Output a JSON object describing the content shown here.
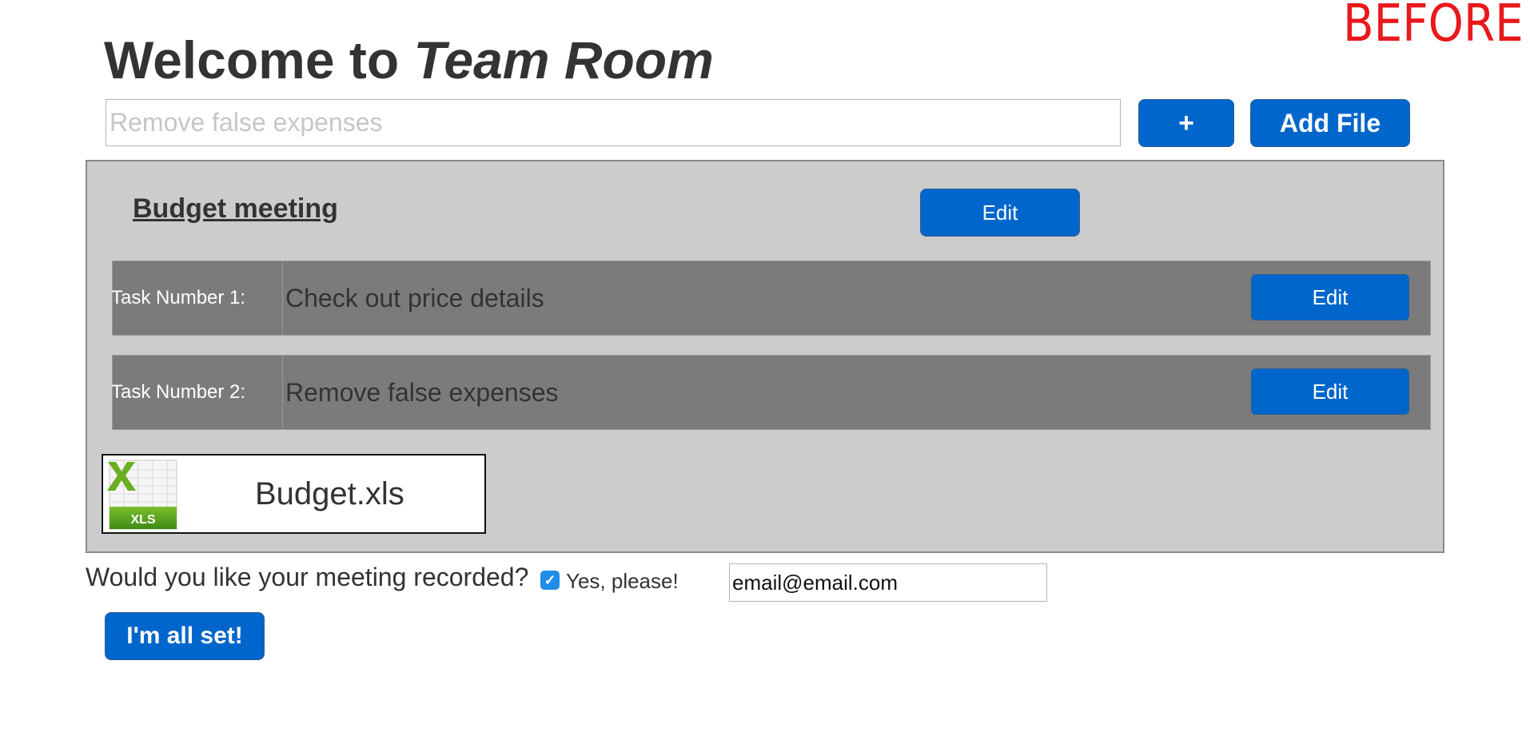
{
  "corner_label": "BEFORE",
  "header": {
    "title_prefix": "Welcome to ",
    "title_emphasis": "Team Room"
  },
  "task_input": {
    "value": "",
    "placeholder": "Remove false expenses"
  },
  "toolbar": {
    "add_label": "+",
    "add_file_label": "Add File"
  },
  "meeting": {
    "title": "Budget meeting",
    "edit_label": "Edit",
    "tasks": [
      {
        "label": "Task Number 1:",
        "text": "Check out price details",
        "edit_label": "Edit"
      },
      {
        "label": "Task Number 2:",
        "text": "Remove false expenses",
        "edit_label": "Edit"
      }
    ],
    "file": {
      "icon": "xls-file-icon",
      "icon_text": "XLS",
      "name": "Budget.xls"
    }
  },
  "recording": {
    "question": "Would you like your meeting recorded?",
    "checked": true,
    "option_label": "Yes, please!",
    "email_value": "email@email.com"
  },
  "submit": {
    "label": "I'm all set!"
  },
  "colors": {
    "button": "#0066cc",
    "panel": "#cccccc",
    "task_row": "#7b7b7b",
    "corner_label": "#e8191c",
    "checkbox": "#1f8dea"
  }
}
